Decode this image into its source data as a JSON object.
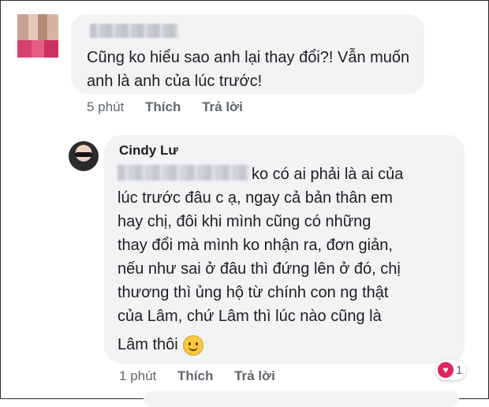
{
  "comment1": {
    "text": "Cũng ko hiểu sao anh lại thay đổi?! Vẫn muốn anh là anh của lúc trước!",
    "time": "5 phút",
    "like_label": "Thích",
    "reply_label": "Trả lời"
  },
  "reply": {
    "author": "Cindy Lư",
    "lines": [
      "ko có ai phải là ai của",
      "lúc trước đâu c ạ, ngay cả bản thân em",
      "hay chị, đôi khi mình cũng có những",
      "thay đổi mà mình ko nhận ra, đơn giản,",
      "nếu như sai ở đâu thì đứng lên ở đó, chị",
      "thương thì ủng hộ từ chính con ng thật",
      "của Lâm, chứ Lâm thì lúc nào cũng là"
    ],
    "last_line": "Lâm thôi",
    "emoji_icon": "smile-emoji",
    "time": "1 phút",
    "like_label": "Thích",
    "reply_label": "Trả lời",
    "reaction_count": "1",
    "reaction_icon": "heart-icon",
    "reaction_color": "#e0245e"
  },
  "colors": {
    "bubble": "#f2f3f5",
    "meta": "#606770",
    "text": "#1c1e21"
  }
}
